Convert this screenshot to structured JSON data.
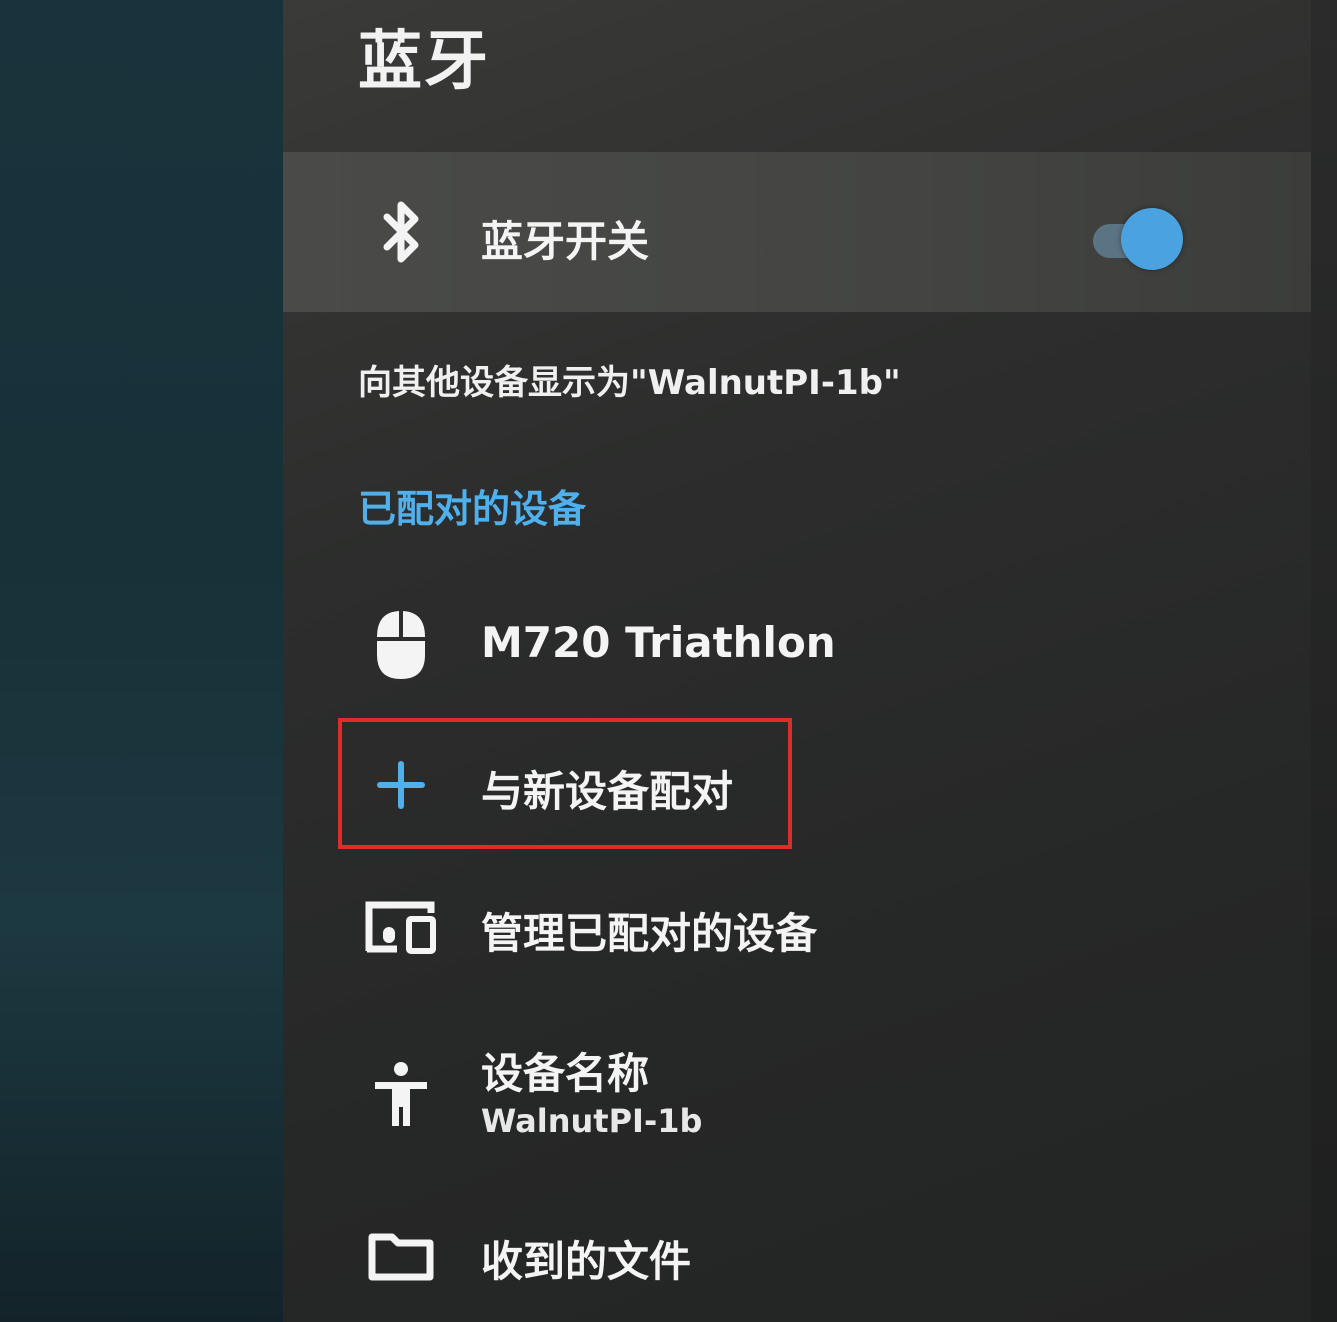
{
  "header": {
    "title": "蓝牙"
  },
  "bluetooth_toggle": {
    "label": "蓝牙开关",
    "icon": "bluetooth-icon",
    "state": "on",
    "accent_color": "#4aa3e0"
  },
  "visibility_text": "向其他设备显示为\"WalnutPI-1b\"",
  "paired_section": {
    "heading": "已配对的设备",
    "heading_color": "#4fb0ec",
    "devices": [
      {
        "name": "M720 Triathlon",
        "icon": "mouse-icon"
      }
    ]
  },
  "actions": {
    "pair_new": {
      "label": "与新设备配对",
      "icon": "plus-icon",
      "highlighted": true
    },
    "manage_paired": {
      "label": "管理已配对的设备",
      "icon": "devices-icon"
    },
    "device_name": {
      "label": "设备名称",
      "value": "WalnutPI-1b",
      "icon": "person-icon"
    },
    "received_files": {
      "label": "收到的文件",
      "icon": "folder-icon"
    }
  },
  "highlight_color": "#e02b2b"
}
